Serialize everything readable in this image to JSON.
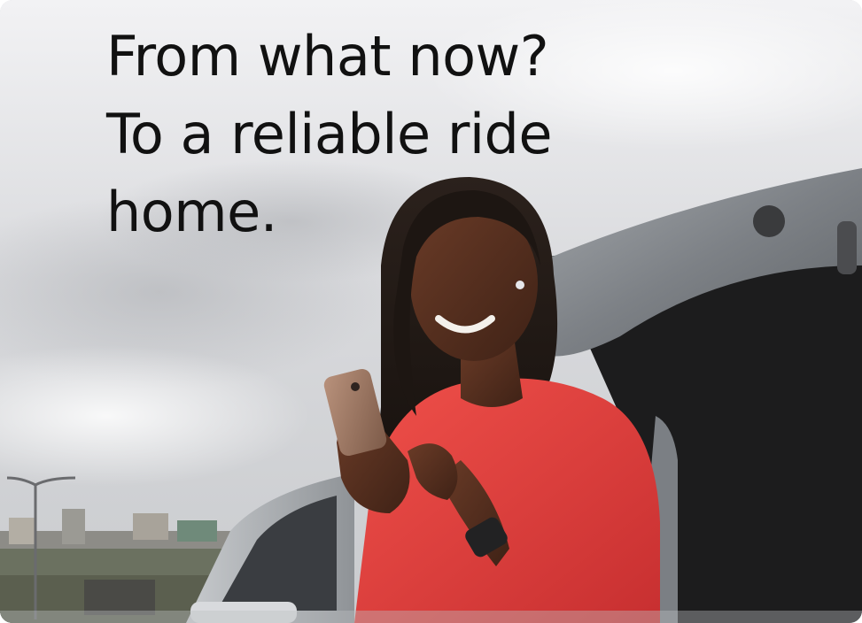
{
  "headline": {
    "line1": "From what now?",
    "line2": "To a reliable ride",
    "line3": "home."
  },
  "colors": {
    "headline_text": "#111111",
    "shirt": "#e23b3b",
    "sky": "#e6e7ea",
    "car_body": "#8e9296",
    "trunk_interior": "#1a1a1b"
  }
}
